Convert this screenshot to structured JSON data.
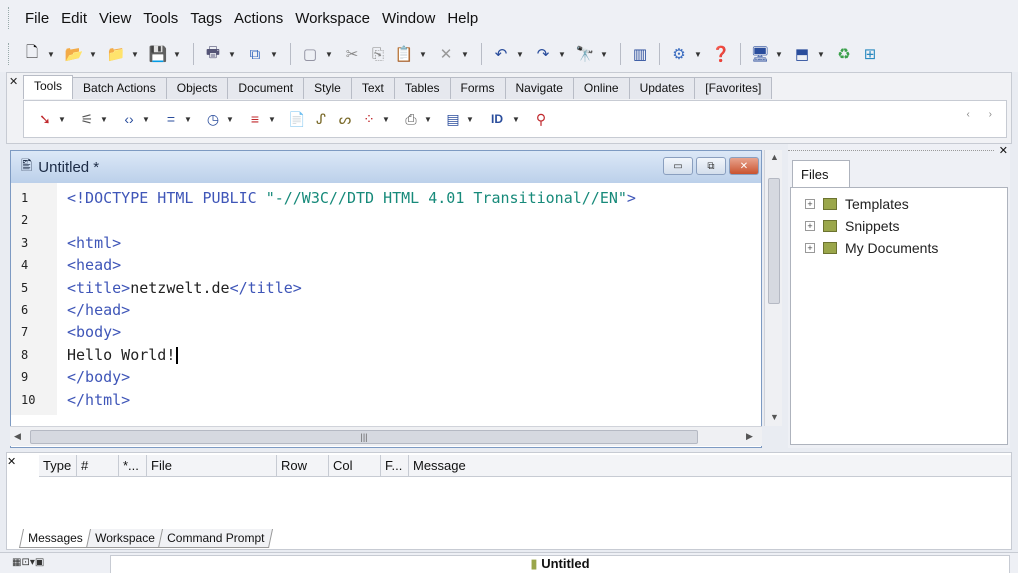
{
  "menu": [
    "File",
    "Edit",
    "View",
    "Tools",
    "Tags",
    "Actions",
    "Workspace",
    "Window",
    "Help"
  ],
  "toolbar_icons": [
    "new-file-icon",
    "open-folder-icon",
    "open-project-icon",
    "save-icon",
    "print-icon",
    "publish-icon",
    "clipboard-icon",
    "cut-icon",
    "copy-icon",
    "paste-icon",
    "delete-icon",
    "undo-icon",
    "redo-icon",
    "find-icon",
    "layout-icon",
    "tree-icon",
    "help-icon",
    "preview-icon",
    "browser-icon",
    "refresh-icon",
    "split-icon"
  ],
  "tag_tabs": [
    "Tools",
    "Batch Actions",
    "Objects",
    "Document",
    "Style",
    "Text",
    "Tables",
    "Forms",
    "Navigate",
    "Online",
    "Updates",
    "[Favorites]"
  ],
  "tools_icons": [
    "marker-icon",
    "wizard-icon",
    "tag-icon",
    "equals-icon",
    "clock-icon",
    "text-icon",
    "doc-icon",
    "script-icon",
    "script2-icon",
    "dots-icon",
    "image-icon",
    "form-icon",
    "id-icon",
    "tree-color-icon"
  ],
  "tools_id_label": "ID",
  "editor": {
    "title": "Untitled *",
    "lines": [
      {
        "num": "1",
        "parts": [
          {
            "t": "<!DOCTYPE HTML PUBLIC ",
            "c": "kw"
          },
          {
            "t": "\"-//W3C//DTD HTML 4.01 Transitional//EN\"",
            "c": "str"
          },
          {
            "t": ">",
            "c": "kw"
          }
        ]
      },
      {
        "num": "2",
        "parts": []
      },
      {
        "num": "3",
        "parts": [
          {
            "t": "<html>",
            "c": "kw"
          }
        ]
      },
      {
        "num": "4",
        "parts": [
          {
            "t": "<head>",
            "c": "kw"
          }
        ]
      },
      {
        "num": "5",
        "parts": [
          {
            "t": "<title>",
            "c": "kw"
          },
          {
            "t": "netzwelt.de",
            "c": "plain"
          },
          {
            "t": "</title>",
            "c": "kw"
          }
        ]
      },
      {
        "num": "6",
        "parts": [
          {
            "t": "</head>",
            "c": "kw"
          }
        ]
      },
      {
        "num": "7",
        "parts": [
          {
            "t": "<body>",
            "c": "kw"
          }
        ]
      },
      {
        "num": "8",
        "parts": [
          {
            "t": "Hello World!",
            "c": "plain"
          }
        ],
        "caret": true
      },
      {
        "num": "9",
        "parts": [
          {
            "t": "</body>",
            "c": "kw"
          }
        ]
      },
      {
        "num": "10",
        "parts": [
          {
            "t": "</html>",
            "c": "kw"
          }
        ]
      }
    ]
  },
  "files_panel": {
    "tab": "Files",
    "items": [
      "Templates",
      "Snippets",
      "My Documents"
    ]
  },
  "messages": {
    "columns": [
      "Type",
      "#",
      "*...",
      "File",
      "Row",
      "Col",
      "F...",
      "Message"
    ],
    "tabs": [
      "Messages",
      "Workspace",
      "Command Prompt"
    ]
  },
  "status": {
    "document": "Untitled"
  }
}
